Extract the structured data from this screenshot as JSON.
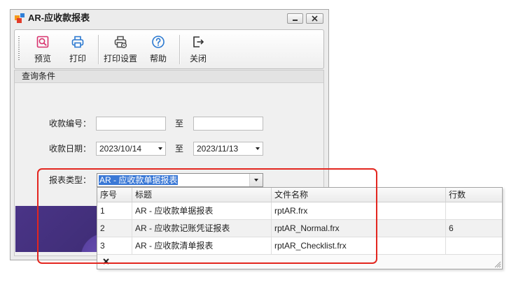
{
  "window": {
    "title": "AR-应收款报表",
    "app_icon": "app-logo-icon",
    "minimize_icon": "minimize-icon",
    "close_icon": "close-icon"
  },
  "toolbar": {
    "buttons": [
      {
        "label": "预览",
        "icon": "preview-icon"
      },
      {
        "label": "打印",
        "icon": "printer-icon"
      },
      {
        "label": "打印设置",
        "icon": "print-settings-icon"
      },
      {
        "label": "帮助",
        "icon": "help-icon"
      },
      {
        "label": "关闭",
        "icon": "exit-icon"
      }
    ]
  },
  "query": {
    "section_title": "查询条件",
    "range_separator": "至",
    "receipt_no": {
      "label": "收款编号：",
      "from_value": "",
      "to_value": ""
    },
    "receipt_date": {
      "label": "收款日期：",
      "from_value": "2023/10/14",
      "to_value": "2023/11/13",
      "dropdown_icon": "chevron-down-icon"
    },
    "report_type": {
      "label": "报表类型：",
      "value": "AR - 应收款单据报表",
      "dropdown_icon": "chevron-down-icon"
    }
  },
  "report_popup": {
    "columns": [
      "序号",
      "标题",
      "文件名称",
      "行数"
    ],
    "rows": [
      {
        "no": "1",
        "title": "AR - 应收款单据报表",
        "file": "rptAR.frx",
        "lines": ""
      },
      {
        "no": "2",
        "title": "AR - 应收款记账凭证报表",
        "file": "rptAR_Normal.frx",
        "lines": "6"
      },
      {
        "no": "3",
        "title": "AR - 应收款清单报表",
        "file": "rptAR_Checklist.frx",
        "lines": ""
      }
    ],
    "close_icon": "close-icon",
    "resize_icon": "resize-grip-icon"
  },
  "theme": {
    "selection": "#3b79d6",
    "annotation": "#e3261f",
    "banner": "#3a2a6e"
  }
}
